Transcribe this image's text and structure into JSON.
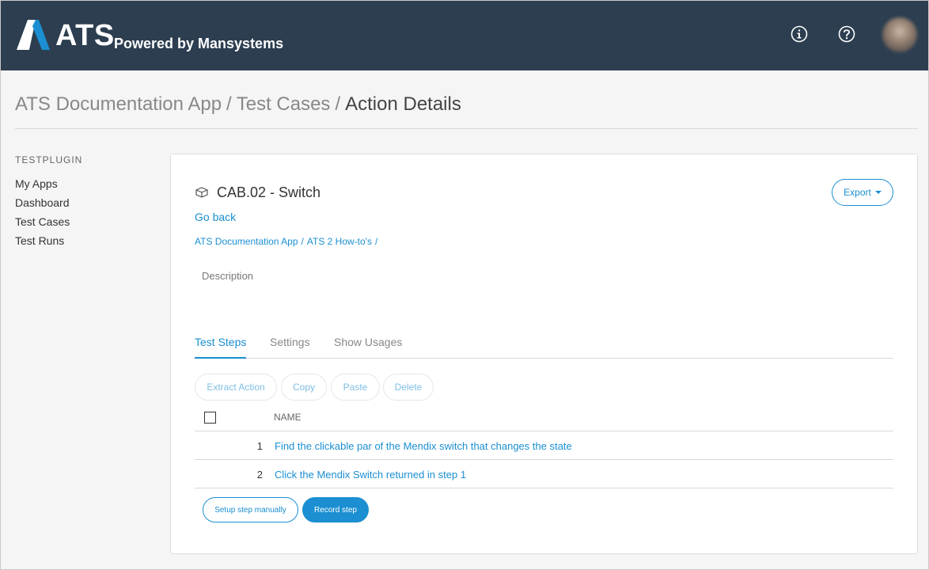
{
  "header": {
    "logo_text": "ATS",
    "logo_subtitle": "Powered by Mansystems",
    "logo_icon": "ats-logo-icon",
    "info_icon": "info-icon",
    "help_icon": "help-icon",
    "avatar_icon": "user-avatar",
    "colors": {
      "background": "#2c3e50",
      "logo_accent": "#1b8fd1"
    }
  },
  "breadcrumb": {
    "items": [
      "ATS Documentation App",
      "Test Cases",
      "Action Details"
    ],
    "separator": "/"
  },
  "sidebar": {
    "heading": "TESTPLUGIN",
    "items": [
      "My Apps",
      "Dashboard",
      "Test Cases",
      "Test Runs"
    ]
  },
  "card": {
    "icon": "cube-icon",
    "title": "CAB.02 - Switch",
    "export_label": "Export",
    "go_back": "Go back",
    "path": [
      "ATS Documentation App",
      "ATS 2 How-to's"
    ],
    "path_separator": "/",
    "description_label": "Description",
    "tabs": [
      {
        "label": "Test Steps",
        "active": true
      },
      {
        "label": "Settings",
        "active": false
      },
      {
        "label": "Show Usages",
        "active": false
      }
    ],
    "actions": [
      "Extract Action",
      "Copy",
      "Paste",
      "Delete"
    ],
    "table": {
      "columns": [
        "NAME"
      ],
      "rows": [
        {
          "num": "1",
          "name": "Find the clickable par of the Mendix switch that changes the state"
        },
        {
          "num": "2",
          "name": "Click the Mendix Switch returned in step 1"
        }
      ]
    },
    "setup_label": "Setup step manually",
    "record_label": "Record step",
    "colors": {
      "link": "#1b8fd1",
      "primary_button": "#1b8fd1"
    }
  }
}
